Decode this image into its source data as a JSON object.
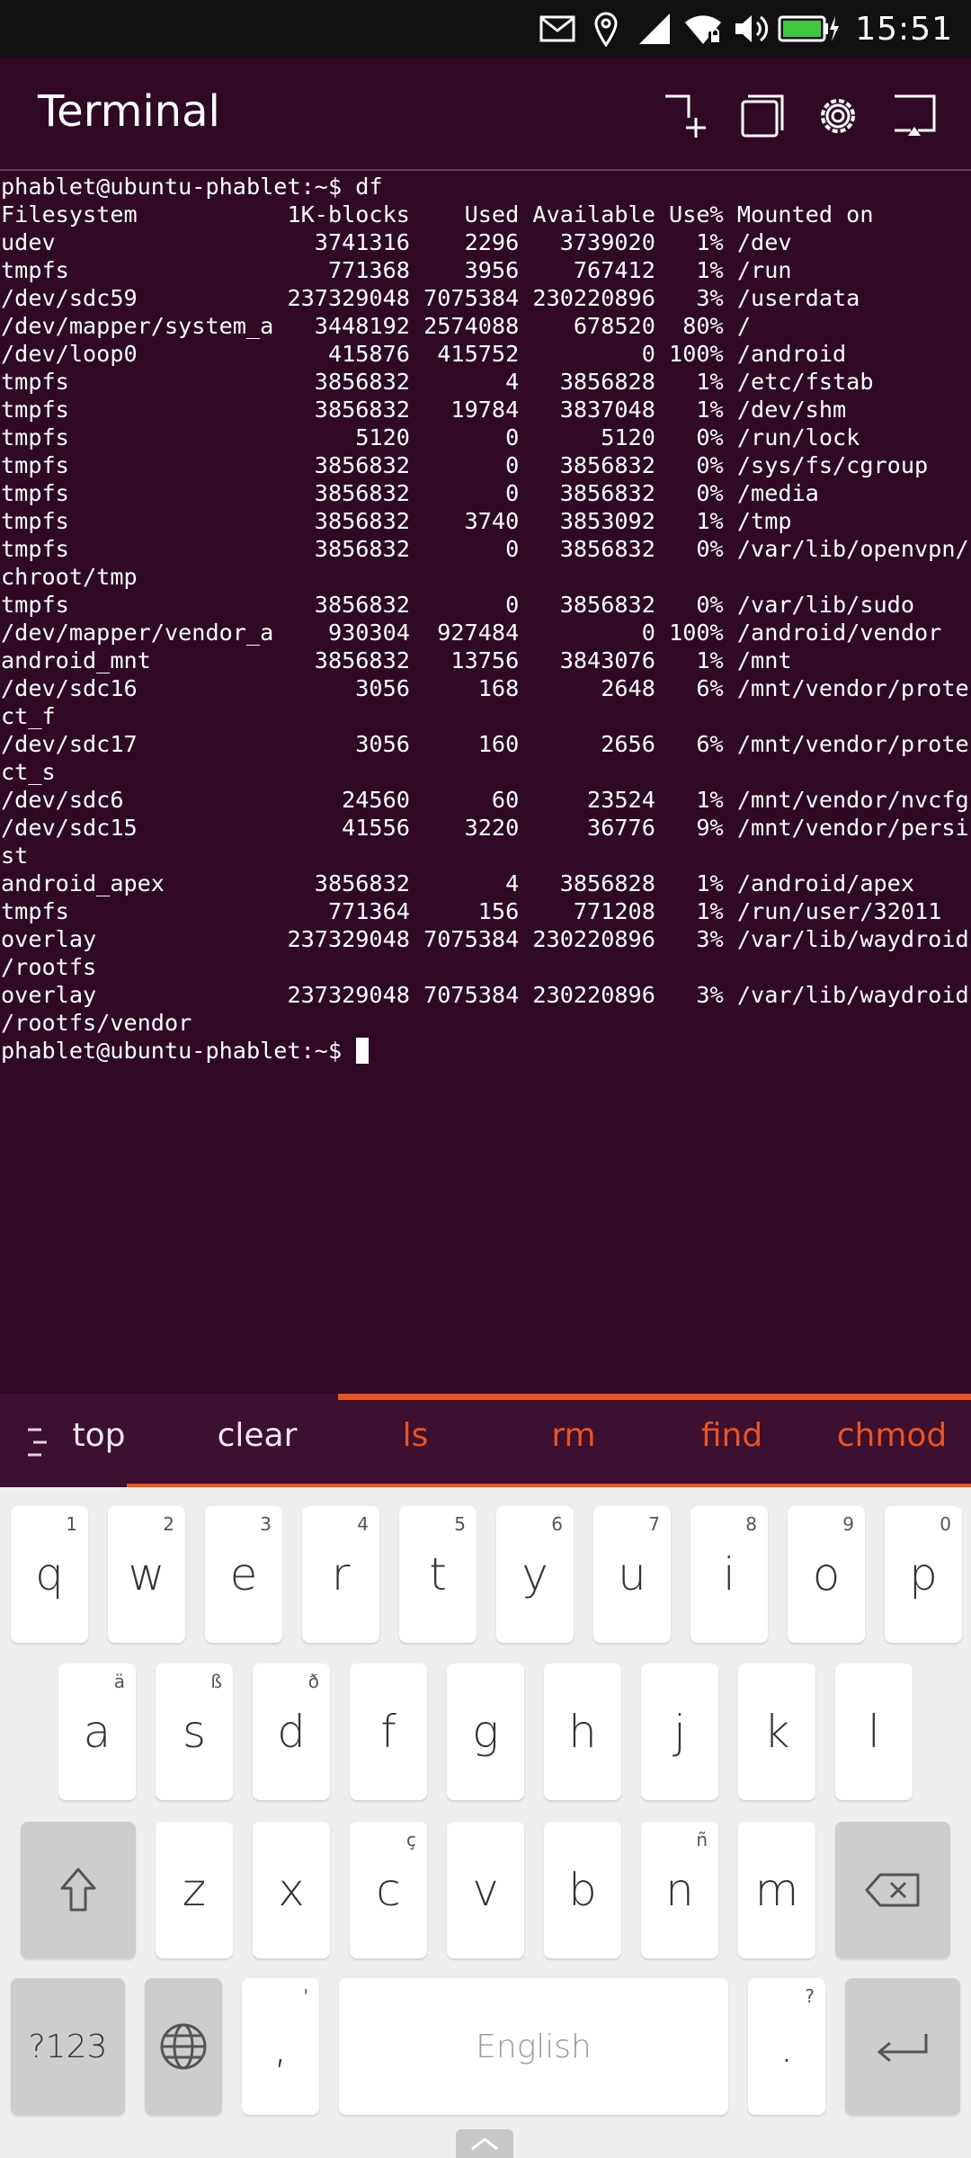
{
  "status_bar": {
    "time": "15:51",
    "icons": [
      "mail-icon",
      "location-icon",
      "signal-icon",
      "wifi-icon",
      "volume-icon",
      "battery-charging-icon"
    ]
  },
  "header": {
    "title": "Terminal",
    "actions": [
      "new-tab-icon",
      "tabs-icon",
      "settings-icon",
      "keyboard-toggle-icon"
    ]
  },
  "terminal": {
    "lines": [
      "phablet@ubuntu-phablet:~$ df",
      "Filesystem           1K-blocks    Used Available Use% Mounted on",
      "udev                   3741316    2296   3739020   1% /dev",
      "tmpfs                   771368    3956    767412   1% /run",
      "/dev/sdc59           237329048 7075384 230220896   3% /userdata",
      "/dev/mapper/system_a   3448192 2574088    678520  80% /",
      "/dev/loop0              415876  415752         0 100% /android",
      "tmpfs                  3856832       4   3856828   1% /etc/fstab",
      "tmpfs                  3856832   19784   3837048   1% /dev/shm",
      "tmpfs                     5120       0      5120   0% /run/lock",
      "tmpfs                  3856832       0   3856832   0% /sys/fs/cgroup",
      "tmpfs                  3856832       0   3856832   0% /media",
      "tmpfs                  3856832    3740   3853092   1% /tmp",
      "tmpfs                  3856832       0   3856832   0% /var/lib/openvpn/",
      "chroot/tmp",
      "tmpfs                  3856832       0   3856832   0% /var/lib/sudo",
      "/dev/mapper/vendor_a    930304  927484         0 100% /android/vendor",
      "android_mnt            3856832   13756   3843076   1% /mnt",
      "/dev/sdc16                3056     168      2648   6% /mnt/vendor/prote",
      "ct_f",
      "/dev/sdc17                3056     160      2656   6% /mnt/vendor/prote",
      "ct_s",
      "/dev/sdc6                24560      60     23524   1% /mnt/vendor/nvcfg",
      "/dev/sdc15               41556    3220     36776   9% /mnt/vendor/persi",
      "st",
      "android_apex           3856832       4   3856828   1% /android/apex",
      "tmpfs                   771364     156    771208   1% /run/user/32011",
      "overlay              237329048 7075384 230220896   3% /var/lib/waydroid",
      "/rootfs",
      "overlay              237329048 7075384 230220896   3% /var/lib/waydroid",
      "/rootfs/vendor"
    ],
    "prompt": "phablet@ubuntu-phablet:~$ "
  },
  "suggestions": {
    "menu_icon": "menu-icon",
    "items": [
      {
        "label": "top",
        "color": "#f0e8ee"
      },
      {
        "label": "clear",
        "color": "#f0e8ee"
      },
      {
        "label": "ls",
        "color": "#e95420"
      },
      {
        "label": "rm",
        "color": "#e95420"
      },
      {
        "label": "find",
        "color": "#e95420"
      },
      {
        "label": "chmod",
        "color": "#e95420"
      }
    ]
  },
  "keyboard": {
    "row1": [
      {
        "key": "q",
        "hint": "1"
      },
      {
        "key": "w",
        "hint": "2"
      },
      {
        "key": "e",
        "hint": "3"
      },
      {
        "key": "r",
        "hint": "4"
      },
      {
        "key": "t",
        "hint": "5"
      },
      {
        "key": "y",
        "hint": "6"
      },
      {
        "key": "u",
        "hint": "7"
      },
      {
        "key": "i",
        "hint": "8"
      },
      {
        "key": "o",
        "hint": "9"
      },
      {
        "key": "p",
        "hint": "0"
      }
    ],
    "row2": [
      {
        "key": "a",
        "hint": "ä"
      },
      {
        "key": "s",
        "hint": "ß"
      },
      {
        "key": "d",
        "hint": "ð"
      },
      {
        "key": "f",
        "hint": ""
      },
      {
        "key": "g",
        "hint": ""
      },
      {
        "key": "h",
        "hint": ""
      },
      {
        "key": "j",
        "hint": ""
      },
      {
        "key": "k",
        "hint": ""
      },
      {
        "key": "l",
        "hint": ""
      }
    ],
    "row3": [
      {
        "key": "z",
        "hint": ""
      },
      {
        "key": "x",
        "hint": ""
      },
      {
        "key": "c",
        "hint": "ç"
      },
      {
        "key": "v",
        "hint": ""
      },
      {
        "key": "b",
        "hint": ""
      },
      {
        "key": "n",
        "hint": "ñ"
      },
      {
        "key": "m",
        "hint": ""
      }
    ],
    "symbols_label": "?123",
    "comma": {
      "key": ",",
      "hint": "'"
    },
    "space_label": "English",
    "period": {
      "key": ".",
      "hint": "?"
    },
    "shift_icon": "shift-icon",
    "backspace_icon": "backspace-icon",
    "globe_icon": "globe-icon",
    "enter_icon": "enter-icon",
    "handle_icon": "chevron-up-icon"
  },
  "colors": {
    "terminal_bg": "#300a24",
    "accent": "#e95420"
  }
}
